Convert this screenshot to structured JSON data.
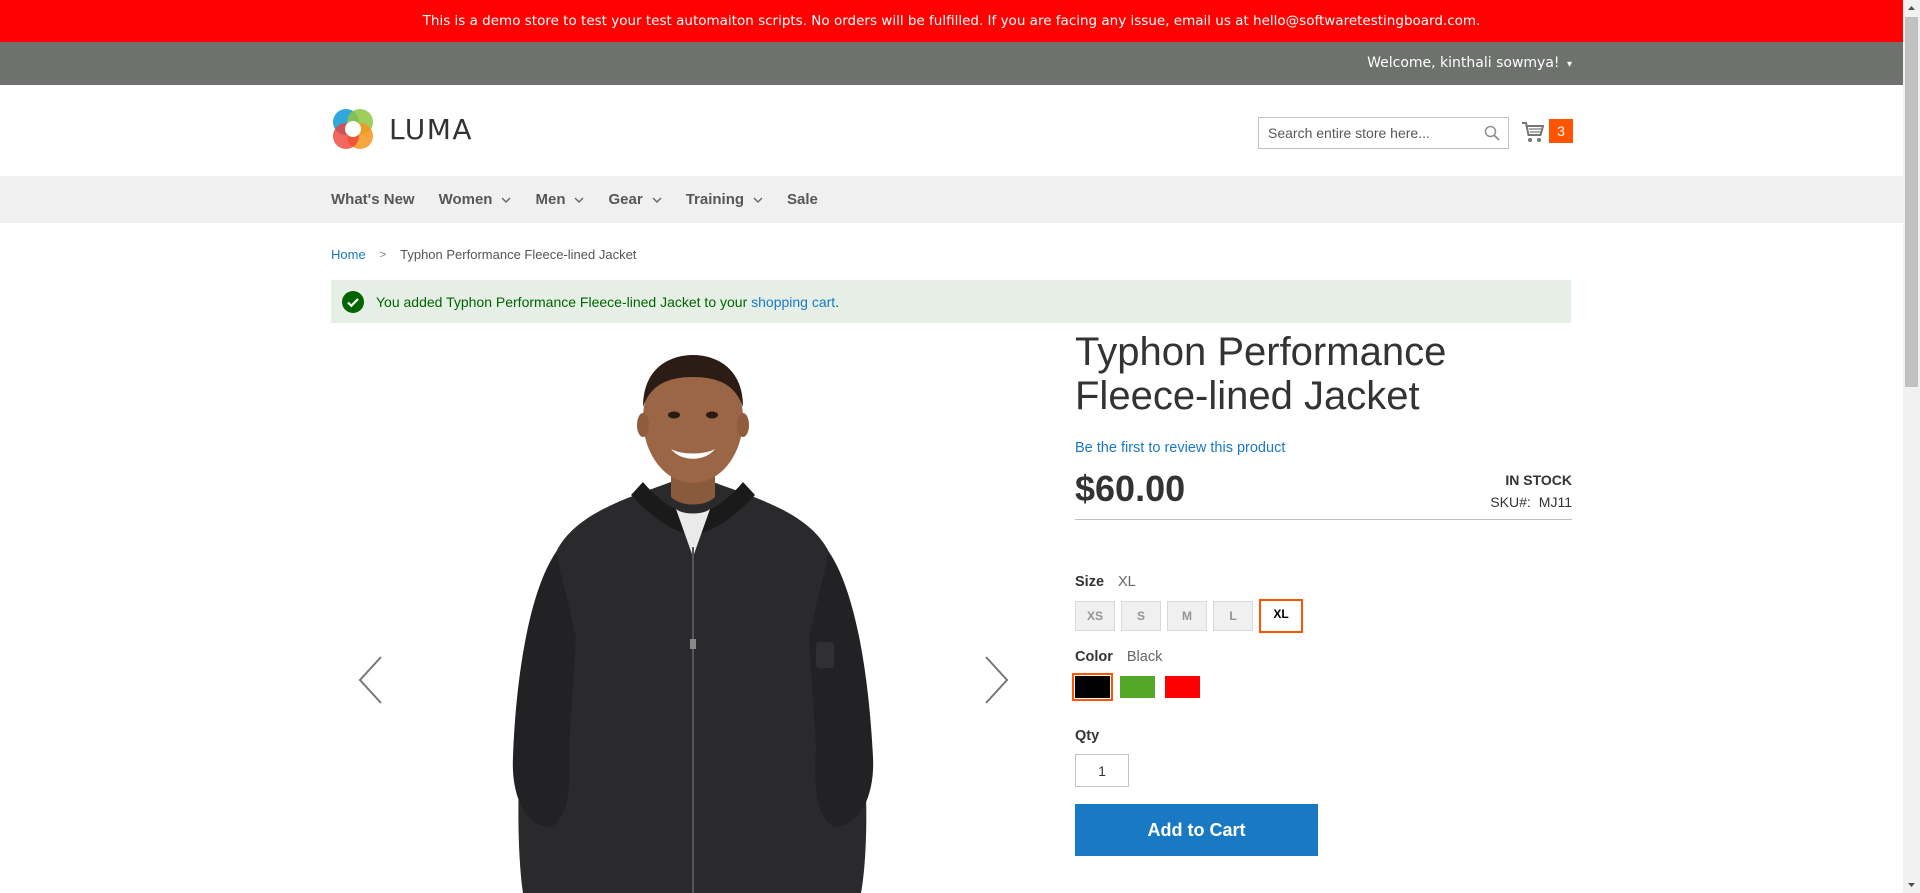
{
  "demo_banner": "This is a demo store to test your test automaiton scripts. No orders will be fulfilled. If you are facing any issue, email us at hello@softwaretestingboard.com.",
  "header": {
    "welcome": "Welcome, kinthali sowmya!",
    "logo_text": "LUMA",
    "search_placeholder": "Search entire store here...",
    "cart_count": "3"
  },
  "nav": {
    "items": [
      "What's New",
      "Women",
      "Men",
      "Gear",
      "Training",
      "Sale"
    ]
  },
  "breadcrumb": {
    "home": "Home",
    "current": "Typhon Performance Fleece-lined Jacket"
  },
  "message": {
    "prefix": "You added Typhon Performance Fleece-lined Jacket to your ",
    "link": "shopping cart",
    "suffix": "."
  },
  "product": {
    "title": "Typhon Performance Fleece-lined Jacket",
    "review_link": "Be the first to review this product",
    "price": "$60.00",
    "stock": "IN STOCK",
    "sku_label": "SKU#:",
    "sku": "MJ11",
    "size_label": "Size",
    "size_selected": "XL",
    "sizes": [
      "XS",
      "S",
      "M",
      "L",
      "XL"
    ],
    "color_label": "Color",
    "color_selected": "Black",
    "colors": [
      "#000000",
      "#53a828",
      "#ff0000"
    ],
    "qty_label": "Qty",
    "qty": "1",
    "add_to_cart": "Add to Cart"
  },
  "colors": {
    "banner": "#ff0101",
    "header_bar": "#6e716e",
    "accent": "#ff5501",
    "link": "#1979c3",
    "success_bg": "#e5efe5"
  }
}
